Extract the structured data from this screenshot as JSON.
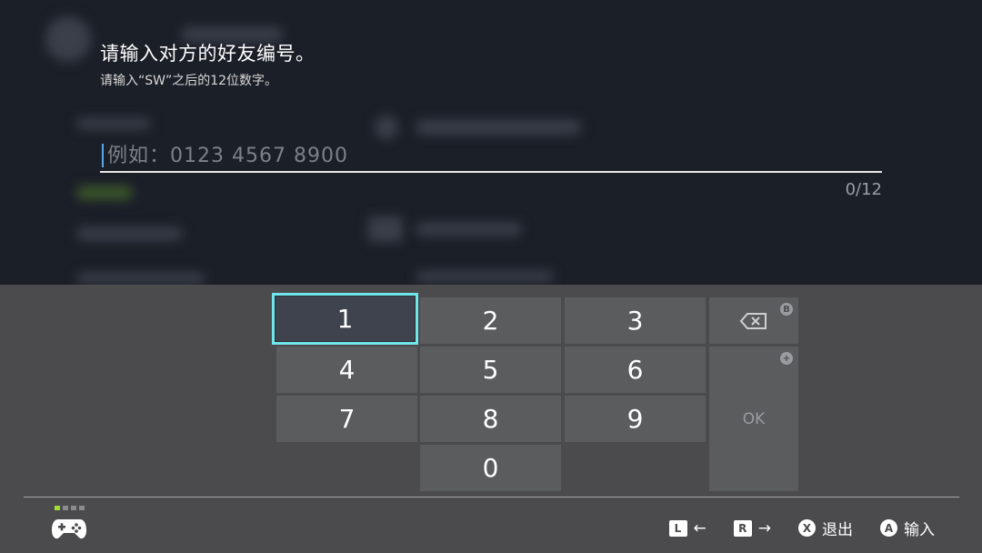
{
  "dialog": {
    "prompt": "请输入对方的好友编号。",
    "subprompt": "请输入“SW”之后的12位数字。"
  },
  "input": {
    "value": "",
    "placeholder": "例如：0123 4567 8900",
    "counter": "0/12"
  },
  "keyboard": {
    "keys": [
      "1",
      "2",
      "3",
      "4",
      "5",
      "6",
      "7",
      "8",
      "9",
      "0"
    ],
    "selected_key": "1",
    "backspace_badge": "B",
    "ok_label": "OK",
    "ok_badge": "+"
  },
  "footer": {
    "page_indicator": {
      "total": 4,
      "active": 1
    },
    "hints": [
      {
        "button": "L",
        "label": "←"
      },
      {
        "button": "R",
        "label": "→"
      },
      {
        "button": "X",
        "label": "退出"
      },
      {
        "button": "A",
        "label": "输入"
      }
    ]
  },
  "colors": {
    "selection_outline": "#6fe6ea",
    "caret": "#5aa7e6",
    "active_dot": "#a4dd33"
  }
}
